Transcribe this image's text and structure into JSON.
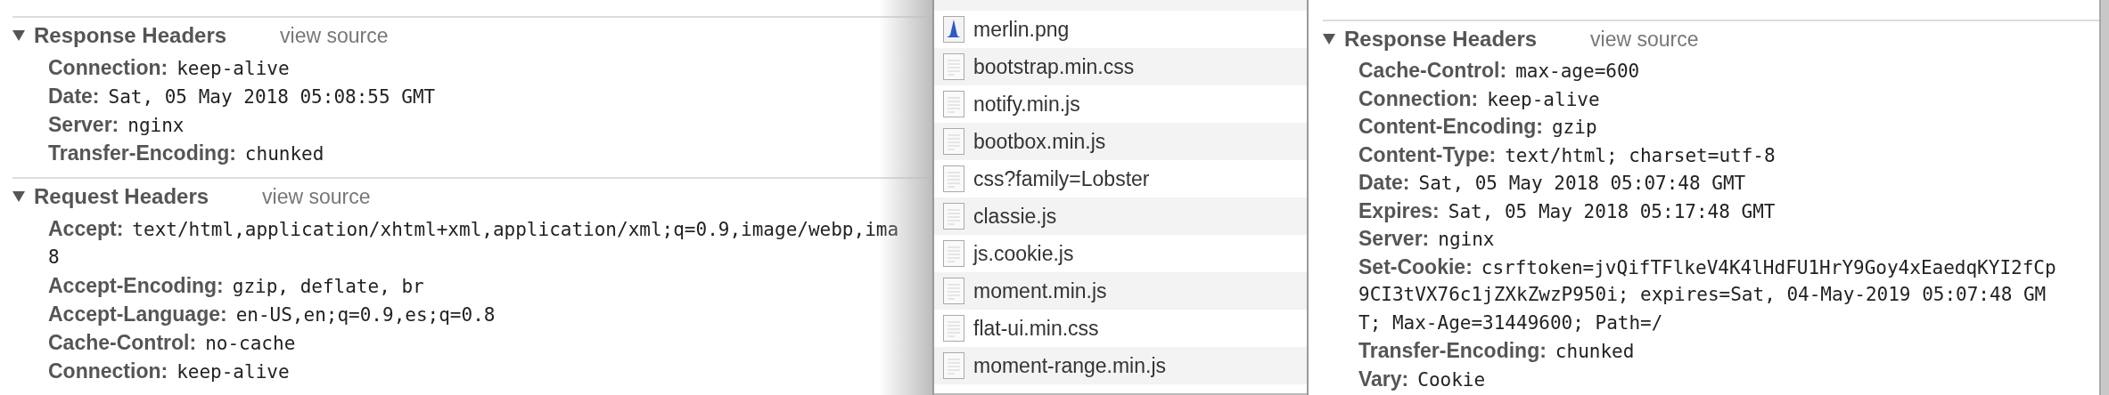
{
  "left_panel": {
    "sections": [
      {
        "title": "Response Headers",
        "link": "view source",
        "expanded": true,
        "headers": [
          {
            "name": "Connection:",
            "value_lines": [
              "keep-alive"
            ]
          },
          {
            "name": "Date:",
            "value_lines": [
              "Sat, 05 May 2018 05:08:55 GMT"
            ]
          },
          {
            "name": "Server:",
            "value_lines": [
              "nginx"
            ]
          },
          {
            "name": "Transfer-Encoding:",
            "value_lines": [
              "chunked"
            ]
          }
        ]
      },
      {
        "title": "Request Headers",
        "link": "view source",
        "expanded": true,
        "headers": [
          {
            "name": "Accept:",
            "value_lines": [
              "text/html,application/xhtml+xml,application/xml;q=0.9,image/webp,ima",
              "8"
            ]
          },
          {
            "name": "Accept-Encoding:",
            "value_lines": [
              "gzip, deflate, br"
            ]
          },
          {
            "name": "Accept-Language:",
            "value_lines": [
              "en-US,en;q=0.9,es;q=0.8"
            ]
          },
          {
            "name": "Cache-Control:",
            "value_lines": [
              "no-cache"
            ]
          },
          {
            "name": "Connection:",
            "value_lines": [
              "keep-alive"
            ]
          }
        ]
      }
    ]
  },
  "file_list": [
    {
      "name": "merlin.png",
      "kind": "image"
    },
    {
      "name": "bootstrap.min.css",
      "kind": "document"
    },
    {
      "name": "notify.min.js",
      "kind": "document"
    },
    {
      "name": "bootbox.min.js",
      "kind": "document"
    },
    {
      "name": "css?family=Lobster",
      "kind": "document"
    },
    {
      "name": "classie.js",
      "kind": "document"
    },
    {
      "name": "js.cookie.js",
      "kind": "document"
    },
    {
      "name": "moment.min.js",
      "kind": "document"
    },
    {
      "name": "flat-ui.min.css",
      "kind": "document"
    },
    {
      "name": "moment-range.min.js",
      "kind": "document"
    }
  ],
  "right_panel": {
    "sections": [
      {
        "title": "Response Headers",
        "link": "view source",
        "expanded": true,
        "headers": [
          {
            "name": "Cache-Control:",
            "value_lines": [
              "max-age=600"
            ]
          },
          {
            "name": "Connection:",
            "value_lines": [
              "keep-alive"
            ]
          },
          {
            "name": "Content-Encoding:",
            "value_lines": [
              "gzip"
            ]
          },
          {
            "name": "Content-Type:",
            "value_lines": [
              "text/html; charset=utf-8"
            ]
          },
          {
            "name": "Date:",
            "value_lines": [
              "Sat, 05 May 2018 05:07:48 GMT"
            ]
          },
          {
            "name": "Expires:",
            "value_lines": [
              "Sat, 05 May 2018 05:17:48 GMT"
            ]
          },
          {
            "name": "Server:",
            "value_lines": [
              "nginx"
            ]
          },
          {
            "name": "Set-Cookie:",
            "value_lines": [
              "csrftoken=jvQifTFlkeV4K4lHdFU1HrY9Goy4xEaedqKYI2fCp",
              "9CI3tVX76c1jZXkZwzP950i; expires=Sat, 04-May-2019 05:07:48 GM",
              "T; Max-Age=31449600; Path=/"
            ]
          },
          {
            "name": "Transfer-Encoding:",
            "value_lines": [
              "chunked"
            ]
          },
          {
            "name": "Vary:",
            "value_lines": [
              "Cookie"
            ]
          }
        ]
      }
    ]
  }
}
